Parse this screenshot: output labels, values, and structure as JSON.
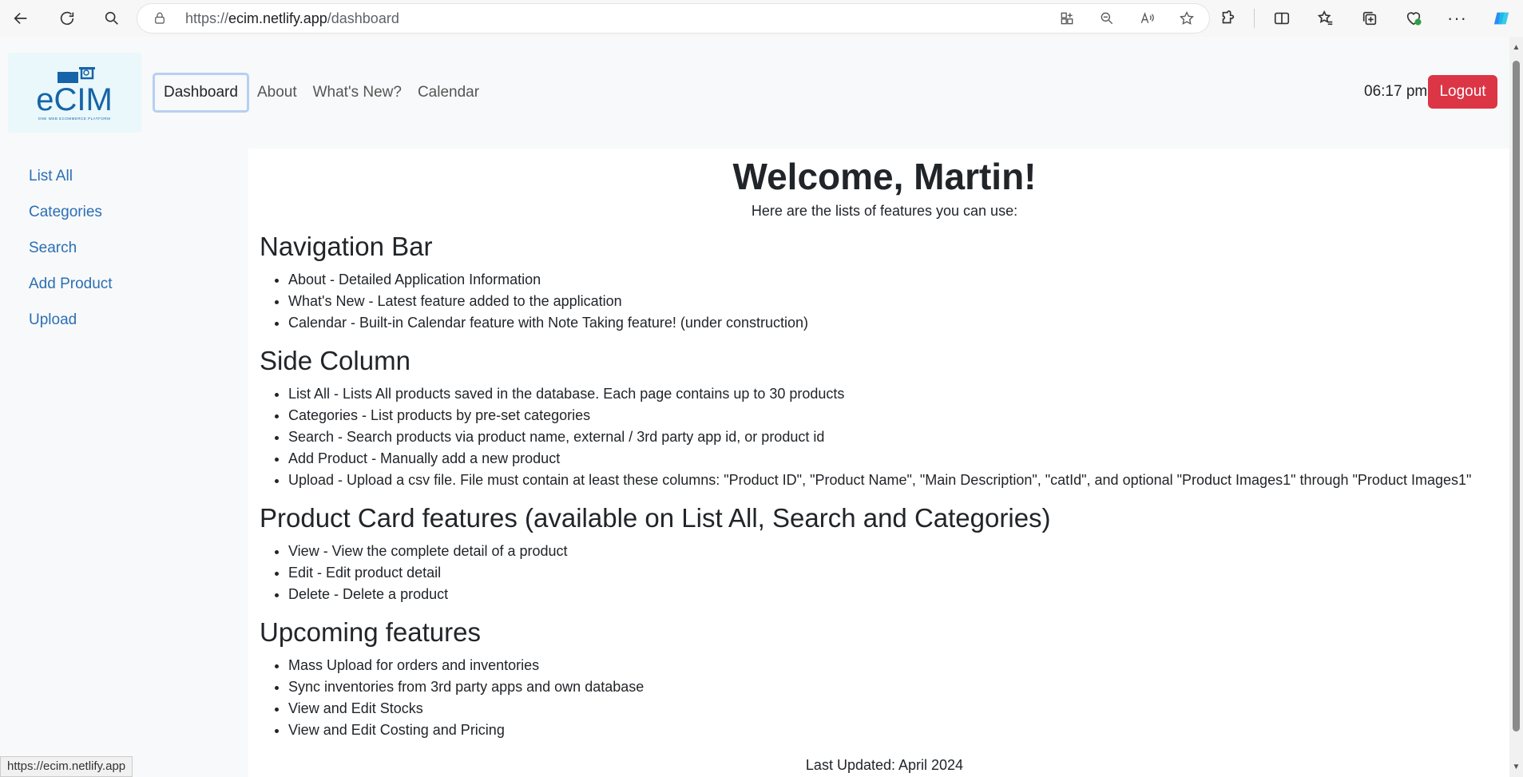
{
  "browser": {
    "url_prefix": "https://",
    "url_host": "ecim.netlify.app",
    "url_path": "/dashboard",
    "status_url": "https://ecim.netlify.app"
  },
  "app": {
    "logo_text": "eCIM",
    "logo_tagline": "ONE WEB ECOMMERCE PLATFORM",
    "nav": [
      {
        "label": "Dashboard"
      },
      {
        "label": "About"
      },
      {
        "label": "What's New?"
      },
      {
        "label": "Calendar"
      }
    ],
    "time": "06:17 pm",
    "logout_label": "Logout",
    "accent": "#dc3545",
    "link_color": "#2b6fb5"
  },
  "sidebar": {
    "items": [
      {
        "label": "List All"
      },
      {
        "label": "Categories"
      },
      {
        "label": "Search"
      },
      {
        "label": "Add Product"
      },
      {
        "label": "Upload"
      }
    ]
  },
  "main": {
    "title": "Welcome, Martin!",
    "subtitle": "Here are the lists of features you can use:",
    "sections": [
      {
        "heading": "Navigation Bar",
        "items": [
          "About - Detailed Application Information",
          "What's New - Latest feature added to the application",
          "Calendar - Built-in Calendar feature with Note Taking feature! (under construction)"
        ]
      },
      {
        "heading": "Side Column",
        "items": [
          "List All - Lists All products saved in the database. Each page contains up to 30 products",
          "Categories - List products by pre-set categories",
          "Search - Search products via product name, external / 3rd party app id, or product id",
          "Add Product - Manually add a new product",
          "Upload - Upload a csv file. File must contain at least these columns: \"Product ID\", \"Product Name\", \"Main Description\", \"catId\", and optional \"Product Images1\" through \"Product Images1\""
        ]
      },
      {
        "heading": "Product Card features (available on List All, Search and Categories)",
        "items": [
          "View - View the complete detail of a product",
          "Edit - Edit product detail",
          "Delete - Delete a product"
        ]
      },
      {
        "heading": "Upcoming features",
        "items": [
          "Mass Upload for orders and inventories",
          "Sync inventories from 3rd party apps and own database",
          "View and Edit Stocks",
          "View and Edit Costing and Pricing"
        ]
      }
    ],
    "last_updated": "Last Updated: April 2024"
  }
}
